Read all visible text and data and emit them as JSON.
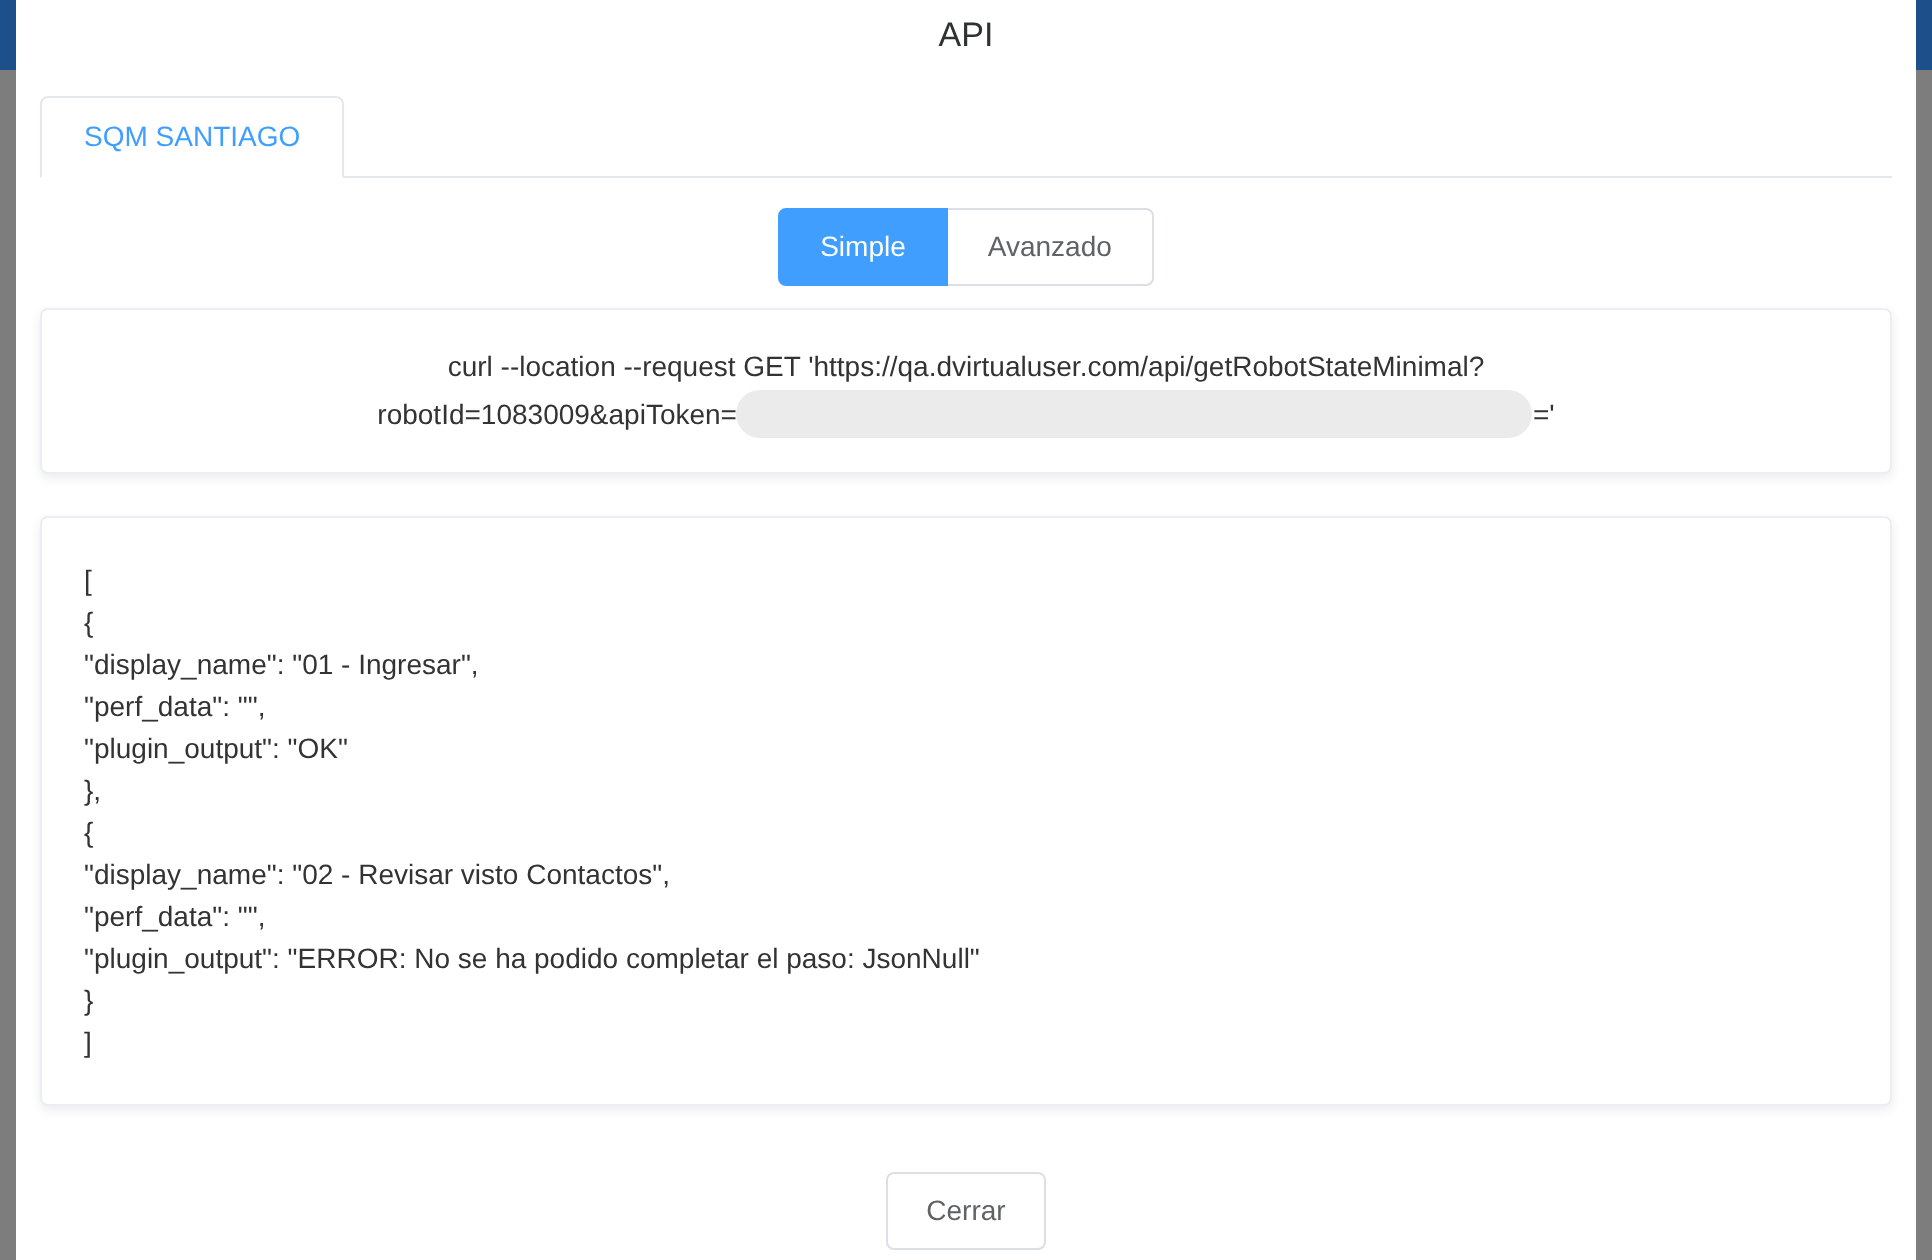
{
  "dialog": {
    "title": "API"
  },
  "tabs": [
    {
      "label": "SQM SANTIAGO",
      "selected": true
    }
  ],
  "modes": [
    {
      "label": "Simple",
      "selected": true
    },
    {
      "label": "Avanzado",
      "selected": false
    }
  ],
  "request": {
    "line_1": "curl --location --request GET 'https://qa.dvirtualuser.com/api/getRobotStateMinimal?",
    "line_2": "robotId=1083009&apiToken=",
    "token_end": "='"
  },
  "response_lines": [
    "[",
    "{",
    "\"display_name\": \"01 - Ingresar\",",
    "\"perf_data\": \"\",",
    "\"plugin_output\": \"OK\"",
    "},",
    "{",
    "\"display_name\": \"02 - Revisar visto Contactos\",",
    "\"perf_data\": \"\",",
    "\"plugin_output\": \"ERROR: No se ha podido completar el paso: JsonNull\"",
    "}",
    "]"
  ],
  "buttons": [
    {
      "label": "Cerrar"
    }
  ]
}
